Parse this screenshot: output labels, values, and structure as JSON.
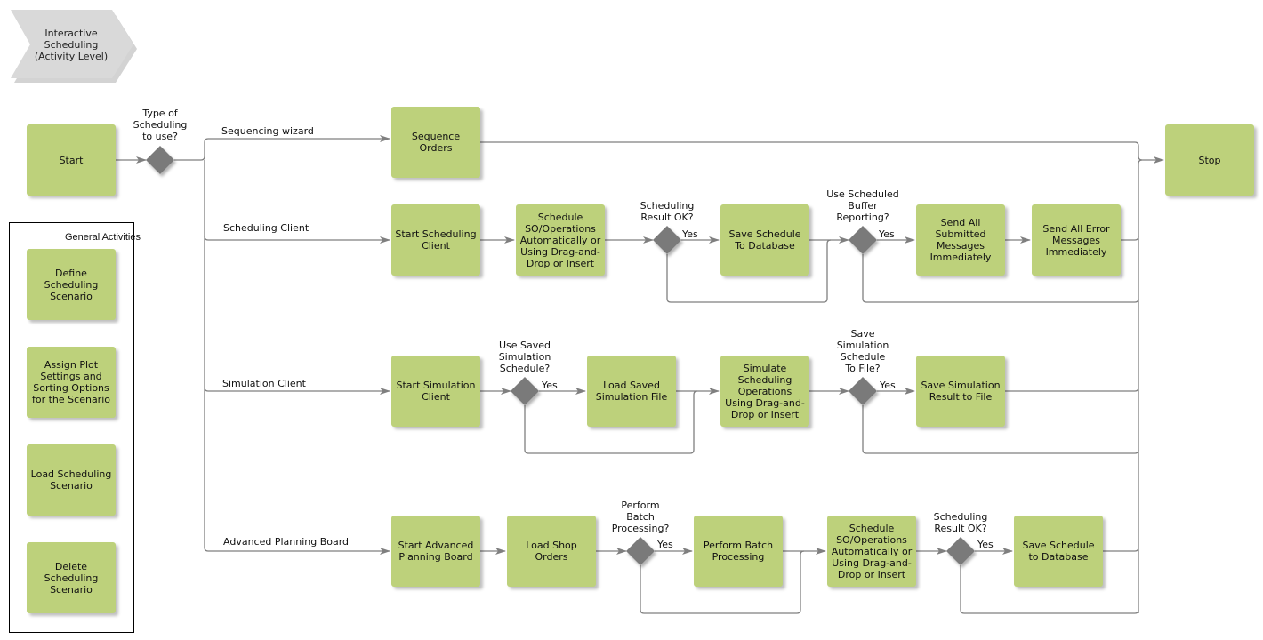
{
  "title": "Interactive\nScheduling\n(Activity Level)",
  "colors": {
    "activity_fill": "#bdd17b",
    "decision_fill": "#7a7a7a",
    "connector": "#7f7f7f",
    "title_fill": "#d9d9d9"
  },
  "general_activities": {
    "title": "General Activities",
    "items": [
      "Define\nScheduling\nScenario",
      "Assign Plot\nSettings and\nSorting Options\nfor the Scenario",
      "Load Scheduling\nScenario",
      "Delete\nScheduling\nScenario"
    ]
  },
  "start": "Start",
  "stop": "Stop",
  "main_decision": "Type of\nScheduling\nto use?",
  "branches": {
    "sequencing": {
      "label": "Sequencing wizard",
      "activities": [
        "Sequence\nOrders"
      ]
    },
    "scheduling_client": {
      "label": "Scheduling Client",
      "activities": [
        "Start Scheduling\nClient",
        "Schedule\nSO/Operations\nAutomatically or\nUsing Drag-and-\nDrop or Insert",
        "Save Schedule\nTo Database",
        "Send All\nSubmitted\nMessages\nImmediately",
        "Send All Error\nMessages\nImmediately"
      ],
      "decisions": [
        "Scheduling\nResult OK?",
        "Use Scheduled\nBuffer\nReporting?"
      ],
      "yes": "Yes"
    },
    "simulation_client": {
      "label": "Simulation Client",
      "activities": [
        "Start Simulation\nClient",
        "Load Saved\nSimulation File",
        "Simulate\nScheduling\nOperations\nUsing Drag-and-\nDrop or Insert",
        "Save Simulation\nResult to File"
      ],
      "decisions": [
        "Use Saved\nSimulation\nSchedule?",
        "Save\nSimulation\nSchedule\nTo File?"
      ],
      "yes": "Yes"
    },
    "advanced_planning_board": {
      "label": "Advanced Planning Board",
      "activities": [
        "Start Advanced\nPlanning Board",
        "Load Shop\nOrders",
        "Perform Batch\nProcessing",
        "Schedule\nSO/Operations\nAutomatically or\nUsing Drag-and-\nDrop or Insert",
        "Save Schedule\nto Database"
      ],
      "decisions": [
        "Perform\nBatch\nProcessing?",
        "Scheduling\nResult OK?"
      ],
      "yes": "Yes"
    }
  }
}
